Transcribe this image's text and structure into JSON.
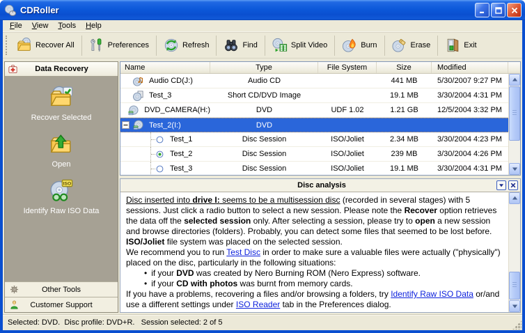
{
  "window": {
    "title": "CDRoller",
    "app_icon": "cd-mouse",
    "controls": [
      {
        "name": "minimize",
        "icon": "minimize-glyph"
      },
      {
        "name": "maximize",
        "icon": "maximize-glyph"
      },
      {
        "name": "close",
        "icon": "close-glyph"
      }
    ]
  },
  "menu": {
    "items": [
      {
        "label": "File"
      },
      {
        "label": "View"
      },
      {
        "label": "Tools"
      },
      {
        "label": "Help"
      }
    ]
  },
  "toolbar": {
    "buttons": [
      {
        "label": "Recover All",
        "icon": "recover-folder-cd"
      },
      {
        "label": "Preferences",
        "icon": "tools"
      },
      {
        "label": "Refresh",
        "icon": "refresh-cd"
      },
      {
        "label": "Find",
        "icon": "binoculars"
      },
      {
        "label": "Split Video",
        "icon": "split-video-cd"
      },
      {
        "label": "Burn",
        "icon": "burn-cd"
      },
      {
        "label": "Erase",
        "icon": "erase-cd"
      },
      {
        "label": "Exit",
        "icon": "exit-door"
      }
    ]
  },
  "sidebar": {
    "header": {
      "label": "Data Recovery",
      "icon": "first-aid"
    },
    "items": [
      {
        "label": "Recover Selected",
        "icon": "folder-cd-check"
      },
      {
        "label": "Open",
        "icon": "folder-arrow"
      },
      {
        "label": "Identify Raw ISO Data",
        "icon": "cd-glasses-iso"
      }
    ],
    "footer": [
      {
        "label": "Other Tools",
        "icon": "gear"
      },
      {
        "label": "Customer Support",
        "icon": "person"
      }
    ]
  },
  "list": {
    "columns": [
      {
        "label": "Name"
      },
      {
        "label": "Type"
      },
      {
        "label": "File System"
      },
      {
        "label": "Size"
      },
      {
        "label": "Modified"
      }
    ],
    "rows": [
      {
        "name": "Audio CD(J:)",
        "icon": "cd-audio",
        "type": "Audio CD",
        "file_system": "",
        "size": "441 MB",
        "modified": "5/30/2007 9:27 PM"
      },
      {
        "name": "Test_3",
        "icon": "cd-image",
        "type": "Short CD/DVD Image",
        "file_system": "",
        "size": "19.1 MB",
        "modified": "3/30/2004 4:31 PM"
      },
      {
        "name": "DVD_CAMERA(H:)",
        "icon": "cd-stack",
        "type": "DVD",
        "file_system": "UDF 1.02",
        "size": "1.21 GB",
        "modified": "12/5/2004 3:32 PM"
      },
      {
        "name": "Test_2(I:)",
        "icon": "cd-stack",
        "expander": "minus",
        "type": "DVD",
        "file_system": "",
        "size": "",
        "modified": "",
        "selected": true
      },
      {
        "name": "Test_1",
        "child": true,
        "radio": "off",
        "type": "Disc Session",
        "file_system": "ISO/Joliet",
        "size": "2.34 MB",
        "modified": "3/30/2004 4:23 PM"
      },
      {
        "name": "Test_2",
        "child": true,
        "radio": "on",
        "type": "Disc Session",
        "file_system": "ISO/Joliet",
        "size": "239 MB",
        "modified": "3/30/2004 4:26 PM"
      },
      {
        "name": "Test_3",
        "child": true,
        "radio": "off",
        "type": "Disc Session",
        "file_system": "ISO/Joliet",
        "size": "19.1 MB",
        "modified": "3/30/2004 4:31 PM"
      }
    ]
  },
  "analysis": {
    "title": "Disc analysis",
    "controls": [
      {
        "name": "collapse",
        "icon": "dropdown-arrow"
      },
      {
        "name": "close",
        "icon": "close-x"
      }
    ],
    "paragraphs": [
      {
        "segments": [
          {
            "t": "Disc inserted into ",
            "u": 1
          },
          {
            "t": "drive I:",
            "b": 1,
            "u": 1
          },
          {
            "t": " seems to be a multisession disc",
            "u": 1
          },
          {
            "t": " (recorded in several stages) with 5 sessions. Just click a radio button to select a new session. Please note the "
          },
          {
            "t": "Recover",
            "b": 1
          },
          {
            "t": " option retrieves the data off the "
          },
          {
            "t": "selected session",
            "b": 1
          },
          {
            "t": " only. After selecting a session, please try to "
          },
          {
            "t": "open",
            "b": 1
          },
          {
            "t": " a new session and browse directories (folders). Probably, you can detect some files that seemed to be lost before."
          }
        ]
      },
      {
        "segments": [
          {
            "t": "ISO/Joliet",
            "b": 1
          },
          {
            "t": "  file system was placed on the selected session."
          }
        ]
      },
      {
        "segments": [
          {
            "t": "We recommend you to run "
          },
          {
            "t": "Test Disc",
            "link": 1
          },
          {
            "t": " in order to make sure a valuable files were actually (\"physically\") placed on the disc, particularly in the following situations:"
          }
        ]
      },
      {
        "bullet": true,
        "segments": [
          {
            "t": "if your "
          },
          {
            "t": "DVD",
            "b": 1
          },
          {
            "t": " was created by Nero Burning ROM (Nero Express) software."
          }
        ]
      },
      {
        "bullet": true,
        "segments": [
          {
            "t": "if your "
          },
          {
            "t": "CD with photos",
            "b": 1
          },
          {
            "t": " was burnt from memory cards."
          }
        ]
      },
      {
        "segments": [
          {
            "t": "If you have a problems, recovering a files and/or browsing a folders, try "
          },
          {
            "t": "Identify Raw ISO Data",
            "link": 1
          },
          {
            "t": " or/and use a different settings under "
          },
          {
            "t": "ISO Reader",
            "link": 1
          },
          {
            "t": " tab in the Preferences dialog."
          }
        ]
      }
    ]
  },
  "status": {
    "text": "Selected: DVD.  Disc profile: DVD+R.   Session selected: 2 of 5"
  }
}
